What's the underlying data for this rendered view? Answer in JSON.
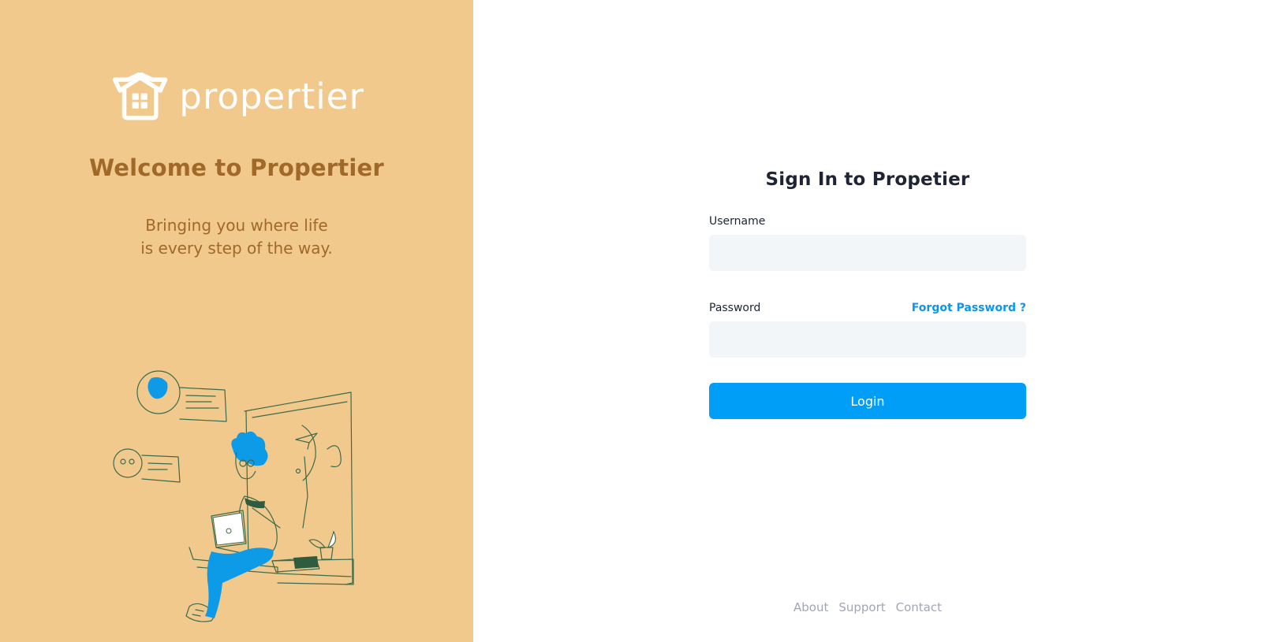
{
  "aside": {
    "logo_text": "propertier",
    "welcome_title": "Welcome to Propertier",
    "welcome_subtitle_line1": "Bringing you where life",
    "welcome_subtitle_line2": "is every step of the way.",
    "background_color": "#f1c98d",
    "text_color": "#a0692a"
  },
  "form": {
    "title": "Sign In to Propetier",
    "username_label": "Username",
    "username_value": "",
    "password_label": "Password",
    "password_value": "",
    "forgot_password_label": "Forgot Password ?",
    "login_label": "Login",
    "accent_color": "#009ef7"
  },
  "footer": {
    "links": [
      "About",
      "Support",
      "Contact"
    ]
  }
}
